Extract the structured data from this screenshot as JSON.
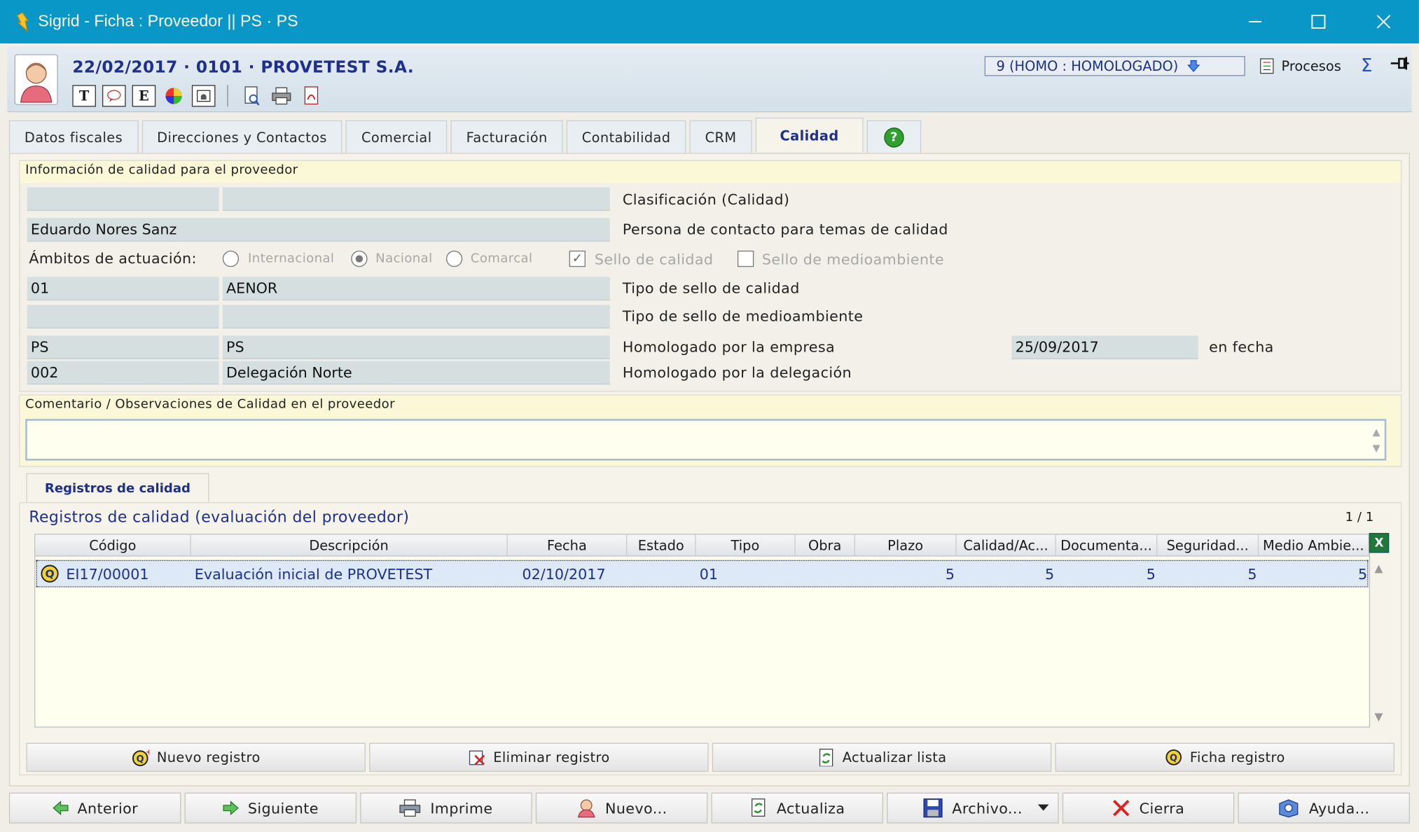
{
  "window": {
    "title": "Sigrid - Ficha : Proveedor || PS · PS"
  },
  "header": {
    "title": "22/02/2017 · 0101 · PROVETEST S.A.",
    "status": "9 (HOMO : HOMOLOGADO)",
    "procesos": "Procesos",
    "tools": [
      "T",
      "E"
    ]
  },
  "tabs": [
    {
      "label": "Datos fiscales"
    },
    {
      "label": "Direcciones y Contactos"
    },
    {
      "label": "Comercial"
    },
    {
      "label": "Facturación"
    },
    {
      "label": "Contabilidad"
    },
    {
      "label": "CRM"
    },
    {
      "label": "Calidad"
    }
  ],
  "help_label": "?",
  "quality": {
    "section_title": "Información de calidad para el proveedor",
    "clasificacion_label": "Clasificación (Calidad)",
    "clasificacion_code": "",
    "clasificacion_desc": "",
    "contact_value": "Eduardo Nores Sanz",
    "contact_label": "Persona de contacto para temas de calidad",
    "ambitos_label": "Ámbitos de actuación:",
    "radio_internacional": "Internacional",
    "radio_nacional": "Nacional",
    "radio_comarcal": "Comarcal",
    "selected_ambito": "Nacional",
    "chk_sello_calidad": "Sello de calidad",
    "chk_sello_calidad_checked": true,
    "chk_sello_medio": "Sello de medioambiente",
    "chk_sello_medio_checked": false,
    "sello_code": "01",
    "sello_desc": "AENOR",
    "sello_label": "Tipo de sello de calidad",
    "medio_code": "",
    "medio_desc": "",
    "medio_label": "Tipo de sello de medioambiente",
    "empresa_code": "PS",
    "empresa_desc": "PS",
    "empresa_label": "Homologado por la empresa",
    "fecha_value": "25/09/2017",
    "fecha_label": "en fecha",
    "delegacion_code": "002",
    "delegacion_desc": "Delegación Norte",
    "delegacion_label": "Homologado por la delegación"
  },
  "comment": {
    "title": "Comentario / Observaciones de Calidad en el proveedor",
    "value": ""
  },
  "records": {
    "subtab": "Registros de calidad",
    "title": "Registros de calidad (evaluación del proveedor)",
    "count": "1 / 1",
    "columns": [
      "Código",
      "Descripción",
      "Fecha",
      "Estado",
      "Tipo",
      "Obra",
      "Plazo",
      "Calidad/Ac...",
      "Documenta...",
      "Seguridad...",
      "Medio Ambie..."
    ],
    "rows": [
      {
        "codigo": "EI17/00001",
        "descripcion": "Evaluación inicial de PROVETEST",
        "fecha": "02/10/2017",
        "estado": "",
        "tipo": "01",
        "obra": "",
        "plazo": "5",
        "calidad": "5",
        "documentacion": "5",
        "seguridad": "5",
        "medio": "5"
      }
    ],
    "buttons": {
      "nuevo": "Nuevo registro",
      "eliminar": "Eliminar registro",
      "actualizar": "Actualizar lista",
      "ficha": "Ficha registro"
    }
  },
  "bottom": {
    "anterior": "Anterior",
    "siguiente": "Siguiente",
    "imprime": "Imprime",
    "nuevo": "Nuevo...",
    "actualiza": "Actualiza",
    "archivo": "Archivo...",
    "cierra": "Cierra",
    "ayuda": "Ayuda..."
  },
  "colors": {
    "titlebar": "#0997c7",
    "accent_text": "#1e2f8c",
    "field_bg": "#d6dfdf",
    "selected_row": "#dde9f7"
  }
}
